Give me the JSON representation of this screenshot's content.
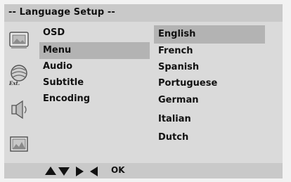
{
  "header": {
    "title": "-- Language Setup --"
  },
  "settings_menu": {
    "items": [
      {
        "label": "OSD",
        "selected": false
      },
      {
        "label": "Menu",
        "selected": true
      },
      {
        "label": "Audio",
        "selected": false
      },
      {
        "label": "Subtitle",
        "selected": false
      },
      {
        "label": "Encoding",
        "selected": false
      }
    ]
  },
  "language_options": {
    "items": [
      {
        "label": "English",
        "selected": true
      },
      {
        "label": "French",
        "selected": false
      },
      {
        "label": "Spanish",
        "selected": false
      },
      {
        "label": "Portuguese",
        "selected": false
      },
      {
        "label": "German",
        "selected": false
      },
      {
        "label": "Italian",
        "selected": false
      },
      {
        "label": "Dutch",
        "selected": false
      }
    ]
  },
  "icons": [
    "general-setup-icon",
    "audio-setup-icon",
    "speaker-icon",
    "picture-setup-icon"
  ],
  "footer": {
    "keys": [
      "up-arrow-icon",
      "down-arrow-icon",
      "right-arrow-icon",
      "left-arrow-icon"
    ],
    "ok_label": "OK"
  }
}
